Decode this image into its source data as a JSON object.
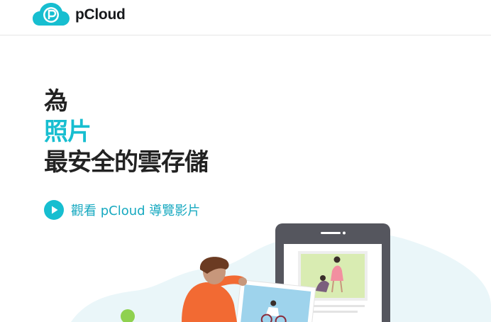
{
  "header": {
    "brand_name": "pCloud",
    "logo_icon": "pcloud-cloud-logo-icon"
  },
  "hero": {
    "line1": "為",
    "line2": "照片",
    "line3": "最安全的雲存儲"
  },
  "video_link": {
    "label": "觀看 pCloud 導覽影片",
    "icon": "play-circle-icon"
  },
  "colors": {
    "accent": "#17bed0",
    "text_dark": "#222222",
    "link": "#17a9c0",
    "illustration_bg": "#eaf6f9"
  }
}
